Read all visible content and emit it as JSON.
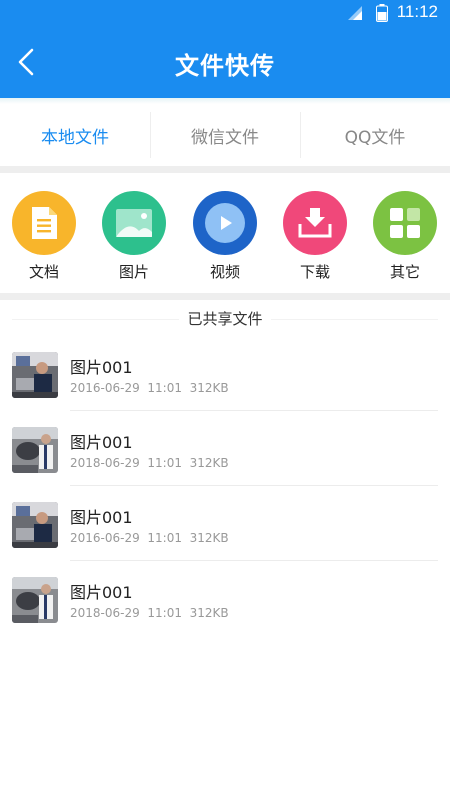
{
  "status_bar": {
    "time": "11:12"
  },
  "app_bar": {
    "title": "文件快传",
    "back_icon": "chevron-left-icon"
  },
  "tabs": [
    {
      "label": "本地文件",
      "active": true
    },
    {
      "label": "微信文件",
      "active": false
    },
    {
      "label": "QQ文件",
      "active": false
    }
  ],
  "categories": [
    {
      "label": "文档",
      "icon": "document-icon",
      "color": "#f8b52b"
    },
    {
      "label": "图片",
      "icon": "image-icon",
      "color": "#2dc08d"
    },
    {
      "label": "视频",
      "icon": "video-play-icon",
      "color": "#1e64c8"
    },
    {
      "label": "下载",
      "icon": "download-icon",
      "color": "#f0487a"
    },
    {
      "label": "其它",
      "icon": "grid-icon",
      "color": "#7cc242"
    }
  ],
  "shared": {
    "title": "已共享文件",
    "files": [
      {
        "name": "图片001",
        "date": "2016-06-29",
        "time": "11:01",
        "size": "312KB"
      },
      {
        "name": "图片001",
        "date": "2018-06-29",
        "time": "11:01",
        "size": "312KB"
      },
      {
        "name": "图片001",
        "date": "2016-06-29",
        "time": "11:01",
        "size": "312KB"
      },
      {
        "name": "图片001",
        "date": "2018-06-29",
        "time": "11:01",
        "size": "312KB"
      }
    ]
  },
  "colors": {
    "primary": "#1a8cf0",
    "separator": "#eeeeee",
    "meta_text": "#999999"
  }
}
